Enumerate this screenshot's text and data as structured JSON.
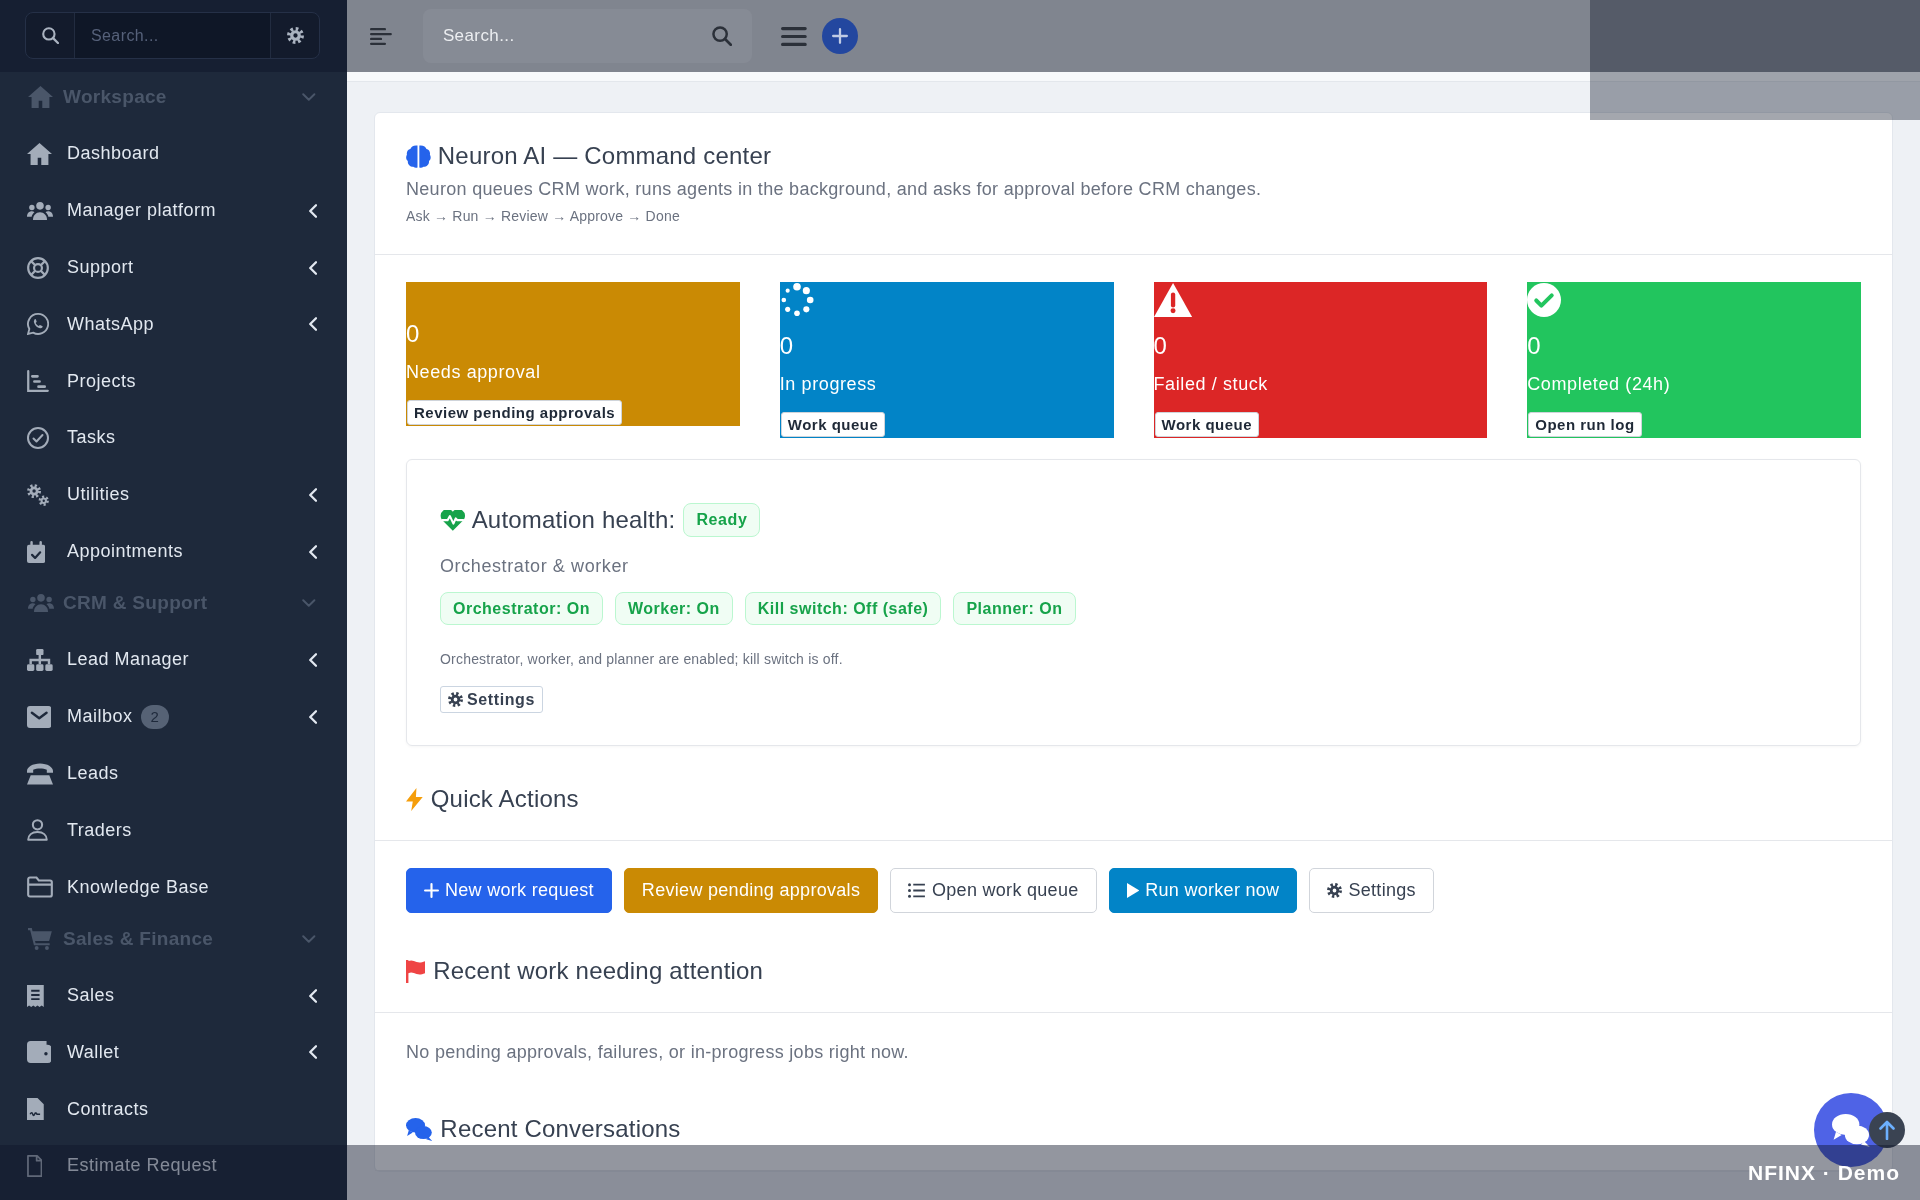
{
  "sidebar": {
    "search": {
      "placeholder": "Search..."
    },
    "sections": [
      {
        "label": "Workspace",
        "expanded": true,
        "children": [
          {
            "label": "Dashboard",
            "kind": "link"
          },
          {
            "label": "Manager platform",
            "kind": "submenu",
            "expanded": false
          },
          {
            "label": "Support",
            "kind": "submenu",
            "expanded": false
          },
          {
            "label": "WhatsApp",
            "kind": "submenu",
            "expanded": false
          },
          {
            "label": "Projects",
            "kind": "link"
          },
          {
            "label": "Tasks",
            "kind": "link"
          },
          {
            "label": "Utilities",
            "kind": "submenu",
            "expanded": false
          },
          {
            "label": "Appointments",
            "kind": "submenu",
            "expanded": false
          }
        ]
      },
      {
        "label": "CRM & Support",
        "expanded": true,
        "children": [
          {
            "label": "Lead Manager",
            "kind": "submenu",
            "expanded": false
          },
          {
            "label": "Mailbox",
            "kind": "submenu",
            "expanded": false,
            "badge": "2"
          },
          {
            "label": "Leads",
            "kind": "link"
          },
          {
            "label": "Traders",
            "kind": "link"
          },
          {
            "label": "Knowledge Base",
            "kind": "link"
          }
        ]
      },
      {
        "label": "Sales & Finance",
        "expanded": true,
        "children": [
          {
            "label": "Sales",
            "kind": "submenu",
            "expanded": false
          },
          {
            "label": "Wallet",
            "kind": "submenu",
            "expanded": false
          },
          {
            "label": "Contracts",
            "kind": "link"
          },
          {
            "label": "Estimate Request",
            "kind": "link"
          }
        ]
      }
    ]
  },
  "topbar": {
    "search": {
      "placeholder": "Search..."
    }
  },
  "header": {
    "title": "Neuron AI — Command center",
    "subtitle": "Neuron queues CRM work, runs agents in the background, and asks for approval before CRM changes.",
    "flow": "Ask → Run → Review → Approve → Done"
  },
  "stat_cards": [
    {
      "value": "0",
      "label": "Needs approval",
      "button": "Review pending approvals",
      "color": "#ca8a04"
    },
    {
      "value": "0",
      "label": "In progress",
      "button": "Work queue",
      "color": "#0284c7"
    },
    {
      "value": "0",
      "label": "Failed / stuck",
      "button": "Work queue",
      "color": "#dc2626"
    },
    {
      "value": "0",
      "label": "Completed (24h)",
      "button": "Open run log",
      "color": "#22c55e"
    }
  ],
  "health": {
    "title": "Automation health:",
    "status": "Ready",
    "subtitle": "Orchestrator & worker",
    "chips": [
      "Orchestrator: On",
      "Worker: On",
      "Kill switch: Off (safe)",
      "Planner: On"
    ],
    "note": "Orchestrator, worker, and planner are enabled; kill switch is off.",
    "button": "Settings"
  },
  "quick_actions": {
    "title": "Quick Actions",
    "buttons": [
      {
        "label": "New work request",
        "kind": "primary"
      },
      {
        "label": "Review pending approvals",
        "kind": "warning"
      },
      {
        "label": "Open work queue",
        "kind": "outline"
      },
      {
        "label": "Run worker now",
        "kind": "info"
      },
      {
        "label": "Settings",
        "kind": "outline"
      }
    ]
  },
  "recent_work": {
    "title": "Recent work needing attention",
    "empty_message": "No pending approvals, failures, or in-progress jobs right now."
  },
  "recent_conversations": {
    "title": "Recent Conversations"
  },
  "demo_bar": {
    "text": "NFINX · Demo"
  }
}
